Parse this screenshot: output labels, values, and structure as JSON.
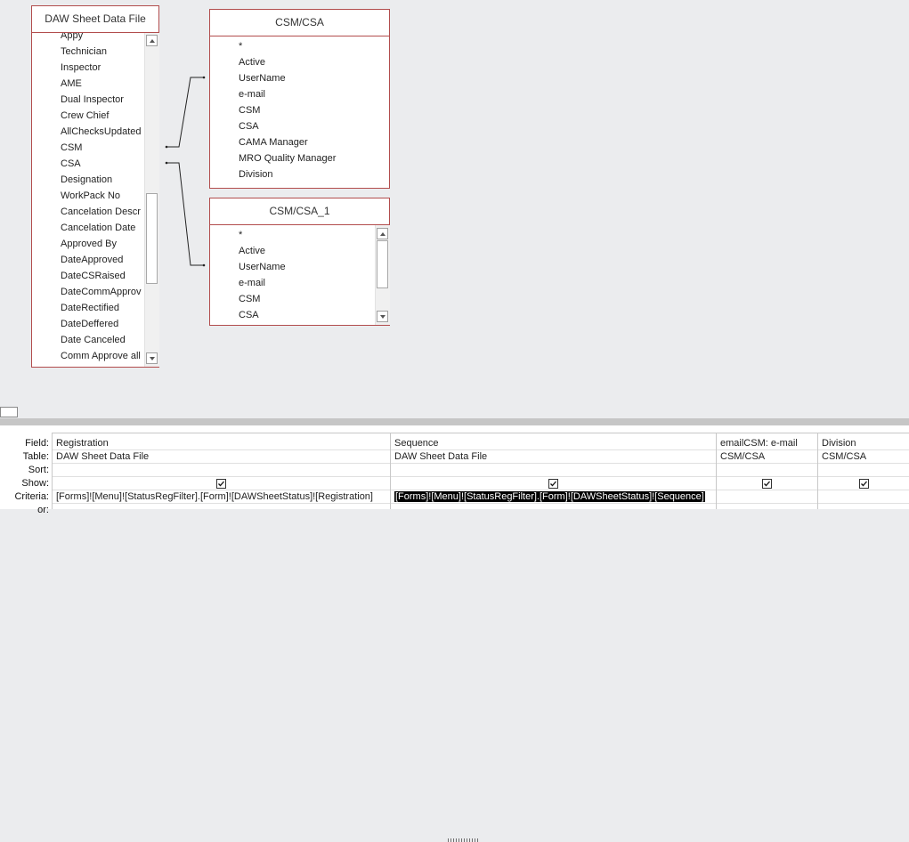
{
  "tables": {
    "daw": {
      "title": "DAW Sheet Data File",
      "fields": [
        "Appy",
        "Technician",
        "Inspector",
        "AME",
        "Dual Inspector",
        "Crew Chief",
        "AllChecksUpdated",
        "CSM",
        "CSA",
        "Designation",
        "WorkPack No",
        "Cancelation Descr",
        "Cancelation Date",
        "Approved By",
        "DateApproved",
        "DateCSRaised",
        "DateCommApprov",
        "DateRectified",
        "DateDeffered",
        "Date Canceled",
        "Comm Approve all"
      ]
    },
    "csm": {
      "title": "CSM/CSA",
      "fields": [
        "*",
        "Active",
        "UserName",
        "e-mail",
        "CSM",
        "CSA",
        "CAMA Manager",
        "MRO Quality Manager",
        "Division"
      ]
    },
    "csm1": {
      "title": "CSM/CSA_1",
      "fields": [
        "*",
        "Active",
        "UserName",
        "e-mail",
        "CSM",
        "CSA"
      ]
    }
  },
  "grid": {
    "row_labels": {
      "field": "Field:",
      "table": "Table:",
      "sort": "Sort:",
      "show": "Show:",
      "criteria": "Criteria:",
      "or": "or:"
    },
    "columns": [
      {
        "field": "Registration",
        "table": "DAW Sheet Data File",
        "show": true,
        "criteria": "[Forms]![Menu]![StatusRegFilter].[Form]![DAWSheetStatus]![Registration]"
      },
      {
        "field": "Sequence",
        "table": "DAW Sheet Data File",
        "show": true,
        "criteria": "[Forms]![Menu]![StatusRegFilter].[Form]![DAWSheetStatus]![Sequence]"
      },
      {
        "field": "emailCSM: e-mail",
        "table": "CSM/CSA",
        "show": true,
        "criteria": ""
      },
      {
        "field": "Division",
        "table": "CSM/CSA",
        "show": true,
        "criteria": ""
      }
    ]
  }
}
